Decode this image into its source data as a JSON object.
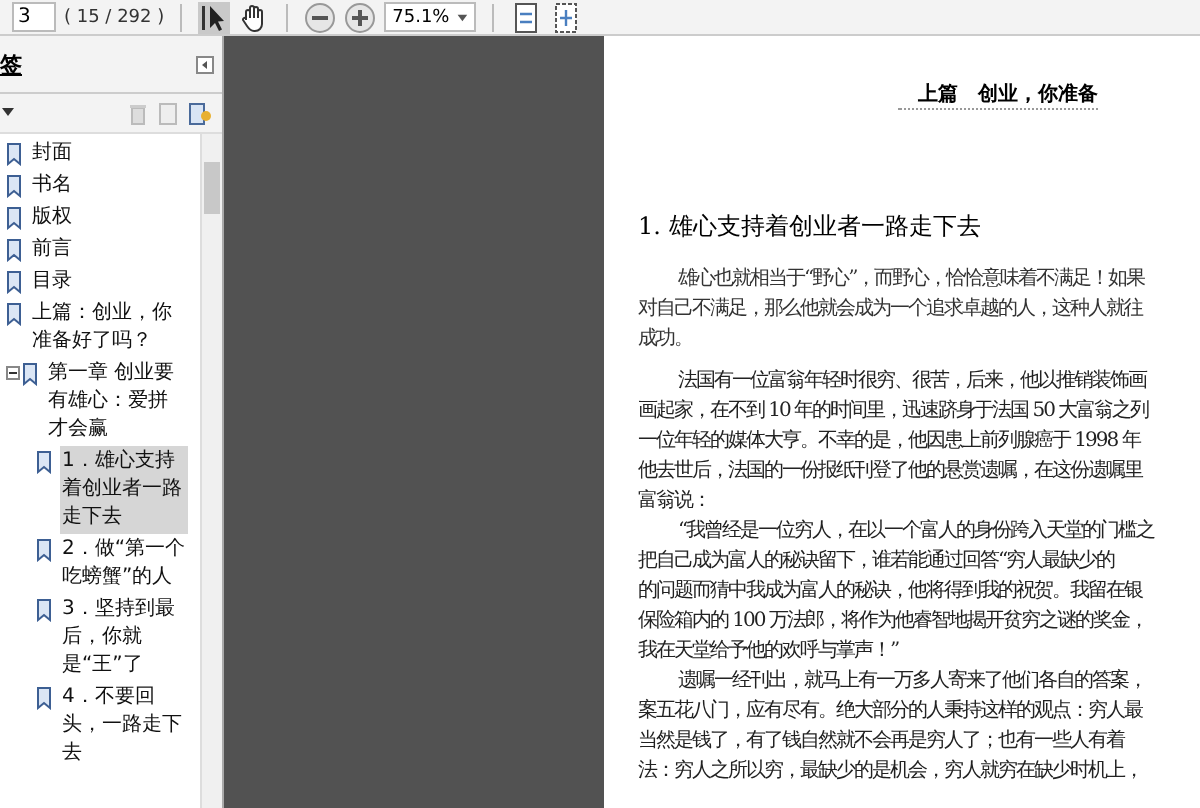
{
  "toolbar": {
    "page_number": "3",
    "page_count": "( 15 / 292 )",
    "tools": [
      {
        "kind": "select",
        "selected": true
      },
      {
        "kind": "hand",
        "selected": false
      }
    ],
    "zoom": "75.1%"
  },
  "panel": {
    "title": "签",
    "tree": [
      {
        "label": "封面"
      },
      {
        "label": "书名"
      },
      {
        "label": "版权"
      },
      {
        "label": "前言"
      },
      {
        "label": "目录"
      },
      {
        "label": "上篇：创业，你准备好了吗？",
        "children": [
          {
            "label": "第一章 创业要有雄心：爱拼才会赢",
            "expanded": true,
            "children": [
              {
                "label": "1．雄心支持着创业者一路走下去",
                "selected": true
              },
              {
                "label": "2．做“第一个吃螃蟹”的人",
                "selected": false
              },
              {
                "label": "3．坚持到最后，你就是“王”了",
                "selected": false
              },
              {
                "label": "4．不要回头，一路走下去",
                "selected": false
              }
            ]
          }
        ]
      }
    ]
  },
  "document": {
    "header": "上篇　创业，你准备",
    "title": "1. 雄心支持着创业者一路走下去",
    "paragraphs": [
      {
        "kind": "quote",
        "lines": [
          "雄心也就相当于“野心”，而野心，恰恰意味着不满足！如果",
          "对自己不满足，那么他就会成为一个追求卓越的人，这种人就往",
          "成功。"
        ]
      },
      {
        "kind": "body",
        "lines": [
          "法国有一位富翁年轻时很穷、很苦，后来，他以推销装饰画",
          "画起家，在不到 10 年的时间里，迅速跻身于法国 50 大富翁之列",
          "一位年轻的媒体大亨。不幸的是，他因患上前列腺癌于 1998 年",
          "他去世后，法国的一份报纸刊登了他的悬赏遗嘱，在这份遗嘱里",
          "富翁说："
        ]
      },
      {
        "kind": "body",
        "lines": [
          "“我曾经是一位穷人，在以一个富人的身份跨入天堂的门槛之",
          "把自己成为富人的秘诀留下，谁若能通过回答“穷人最缺少的",
          "的问题而猜中我成为富人的秘诀，他将得到我的祝贺。我留在银",
          "保险箱内的 100 万法郎，将作为他睿智地揭开贫穷之谜的奖金，",
          "我在天堂给予他的欢呼与掌声！”"
        ]
      },
      {
        "kind": "body",
        "lines": [
          "遗嘱一经刊出，就马上有一万多人寄来了他们各自的答案，",
          "案五花八门，应有尽有。绝大部分的人秉持这样的观点：穷人最",
          "当然是钱了，有了钱自然就不会再是穷人了；也有一些人有着",
          "法：穷人之所以穷，最缺少的是机会，穷人就穷在缺少时机上，"
        ]
      }
    ]
  }
}
